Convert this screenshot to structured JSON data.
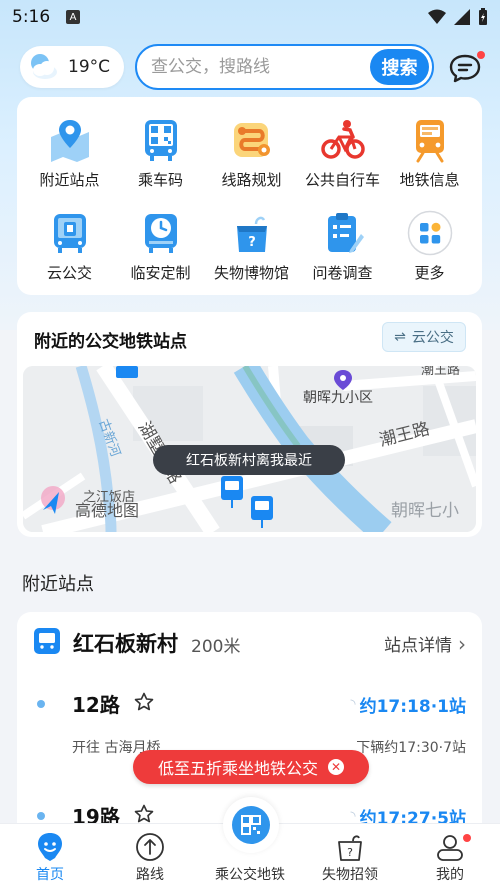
{
  "status_bar": {
    "time": "5:16",
    "notif_badge": "A"
  },
  "header": {
    "temperature": "19°C",
    "search_placeholder": "查公交，搜路线",
    "search_button": "搜索"
  },
  "quick_grid": [
    {
      "label": "附近站点",
      "icon": "location-pin-map-icon"
    },
    {
      "label": "乘车码",
      "icon": "bus-qr-code-icon"
    },
    {
      "label": "线路规划",
      "icon": "route-plan-icon"
    },
    {
      "label": "公共自行车",
      "icon": "bicycle-icon"
    },
    {
      "label": "地铁信息",
      "icon": "metro-train-icon"
    },
    {
      "label": "云公交",
      "icon": "cloud-bus-icon"
    },
    {
      "label": "临安定制",
      "icon": "custom-clock-bus-icon"
    },
    {
      "label": "失物博物馆",
      "icon": "lost-item-box-icon"
    },
    {
      "label": "问卷调查",
      "icon": "survey-clipboard-icon"
    },
    {
      "label": "更多",
      "icon": "more-apps-icon"
    }
  ],
  "nearby_map": {
    "title": "附近的公交地铁站点",
    "cloud_chip": "云公交",
    "tooltip": "红石板新村离我最近",
    "map_labels": {
      "area1": "朝晖九小区",
      "area2": "朝晖七小",
      "road1": "潮王路",
      "road2": "湖墅南路",
      "road3": "古新河",
      "poi": "之江饭店",
      "top_right": "潮王路",
      "logo": "高德地图"
    }
  },
  "nearby_section": {
    "title": "附近站点"
  },
  "station": {
    "name": "红石板新村",
    "distance": "200米",
    "detail_link": "站点详情",
    "routes": [
      {
        "name": "12路",
        "eta": "约17:18·1站",
        "direction": "开往 古海月桥",
        "next": "下辆约17:30·7站"
      },
      {
        "name": "19路",
        "eta": "约17:27·5站"
      }
    ]
  },
  "promo": {
    "text": "低至五折乘坐地铁公交"
  },
  "bottom_nav": [
    {
      "label": "首页",
      "icon": "home-smile-icon",
      "active": true
    },
    {
      "label": "路线",
      "icon": "route-compass-icon",
      "active": false
    },
    {
      "label": "乘公交地铁",
      "icon": "qr-scan-icon",
      "active": false
    },
    {
      "label": "失物招领",
      "icon": "lost-found-box-icon",
      "active": false
    },
    {
      "label": "我的",
      "icon": "profile-icon",
      "active": false
    }
  ],
  "colors": {
    "accent": "#1a88f2",
    "promo": "#ee3b3b"
  }
}
